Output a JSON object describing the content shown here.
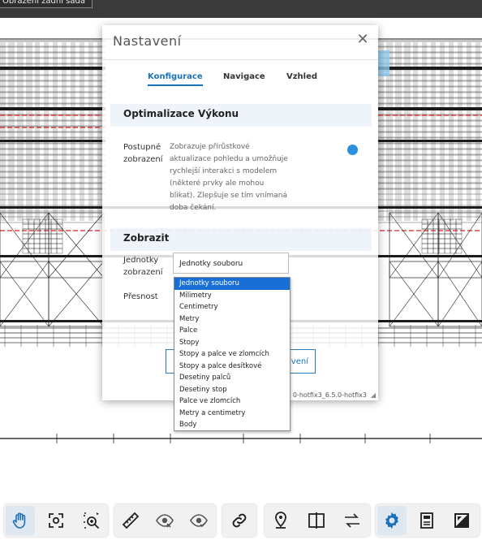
{
  "topbar": {
    "button_label": "Obrazení zadní sada"
  },
  "dialog": {
    "title": "Nastavení",
    "tabs": [
      {
        "label": "Konfigurace",
        "active": true
      },
      {
        "label": "Navigace",
        "active": false
      },
      {
        "label": "Vzhled",
        "active": false
      }
    ],
    "sections": [
      {
        "title": "Optimalizace Výkonu",
        "rows": [
          {
            "label_lines": [
              "Postupné",
              "zobrazení"
            ],
            "description_lines": [
              "Zobrazuje přírůstkové",
              "aktualizace pohledu a umožňuje",
              "rychlejší interakci s modelem",
              "(některé prvky ale mohou",
              "blikat). Zlepšuje se tím vnímaná",
              "doba čekání."
            ],
            "toggle_on": true
          }
        ]
      },
      {
        "title": "Zobrazit",
        "rows": [
          {
            "label_lines": [
              "Jednotky",
              "zobrazení"
            ],
            "select_value": "Jednotky souboru"
          },
          {
            "label_lines": [
              "Přesnost"
            ]
          }
        ]
      }
    ],
    "button_partial_label": "avení",
    "version_text": "0-hotfix3_6.5.0-hotfix3"
  },
  "units_dropdown": {
    "options": [
      "Jednotky souboru",
      "Milimetry",
      "Centimetry",
      "Metry",
      "Palce",
      "Stopy",
      "Stopy a palce ve zlomcích",
      "Stopy a palce desítkové",
      "Desetiny palců",
      "Desetiny stop",
      "Palce ve zlomcích",
      "Metry a centimetry",
      "Body"
    ],
    "selected_index": 0
  },
  "toolbar": {
    "groups": [
      [
        "pan-hand-icon",
        "fit-to-view-icon",
        "zoom-window-icon"
      ],
      [
        "measure-ruler-icon",
        "hide-eye-icon",
        "show-eye-icon"
      ],
      [
        "link-chain-icon"
      ],
      [
        "location-pin-icon",
        "split-compare-icon",
        "swap-arrows-icon"
      ],
      [
        "settings-gear-icon",
        "properties-panel-icon",
        "fullscreen-icon"
      ]
    ],
    "active_icons": [
      "pan-hand-icon",
      "settings-gear-icon"
    ],
    "accent": "#1a73b8"
  }
}
